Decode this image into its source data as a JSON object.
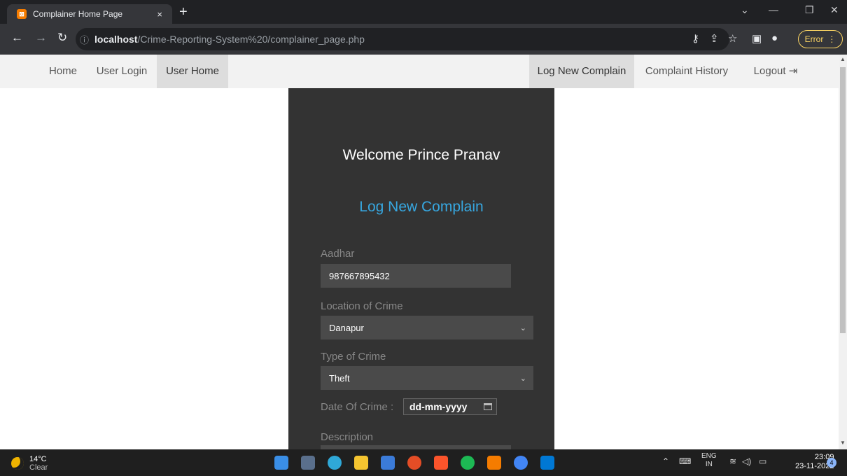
{
  "browser": {
    "tab_title": "Complainer Home Page",
    "tab_close": "×",
    "new_tab": "+",
    "url_host": "localhost",
    "url_path": "/Crime-Reporting-System%20/complainer_page.php",
    "error_label": "Error"
  },
  "nav": {
    "home": "Home",
    "user_login": "User Login",
    "user_home": "User Home",
    "log_new_complain": "Log New Complain",
    "complaint_history": "Complaint History",
    "logout": "Logout"
  },
  "form": {
    "welcome": "Welcome Prince Pranav",
    "title": "Log New Complain",
    "aadhar_label": "Aadhar",
    "aadhar_value": "987667895432",
    "location_label": "Location of Crime",
    "location_value": "Danapur",
    "type_label": "Type of Crime",
    "type_value": "Theft",
    "date_label": "Date Of Crime :",
    "date_placeholder": "dd-mm-yyyy",
    "description_label": "Description"
  },
  "taskbar": {
    "temp": "14°C",
    "condition": "Clear",
    "lang": "ENG",
    "region": "IN",
    "time": "23:09",
    "date": "23-11-2022",
    "notification_count": "4"
  },
  "colors": {
    "panel_bg": "#333333",
    "title_blue": "#37a7e0",
    "nav_bg": "#f2f2f2"
  }
}
